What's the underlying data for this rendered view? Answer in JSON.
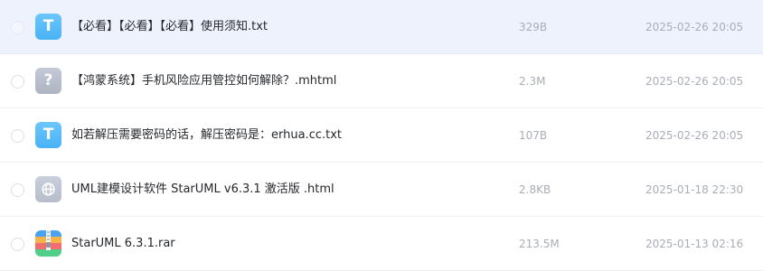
{
  "files": [
    {
      "name": "【必看】【必看】【必看】使用须知.txt",
      "size": "329B",
      "date": "2025-02-26 20:05",
      "icon": "txt-file-icon",
      "icon_glyph": "T"
    },
    {
      "name": "【鸿蒙系统】手机风险应用管控如何解除？.mhtml",
      "size": "2.3M",
      "date": "2025-02-26 20:05",
      "icon": "unknown-file-icon",
      "icon_glyph": "?"
    },
    {
      "name": "如若解压需要密码的话，解压密码是：erhua.cc.txt",
      "size": "107B",
      "date": "2025-02-26 20:05",
      "icon": "txt-file-icon",
      "icon_glyph": "T"
    },
    {
      "name": "UML建模设计软件 StarUML v6.3.1 激活版 .html",
      "size": "2.8KB",
      "date": "2025-01-18 22:30",
      "icon": "html-file-icon"
    },
    {
      "name": "StarUML 6.3.1.rar",
      "size": "213.5M",
      "date": "2025-01-13 02:16",
      "icon": "archive-file-icon"
    }
  ],
  "colors": {
    "hover_row": "#eef2fd",
    "txt_icon": "#55b9f8",
    "unknown_icon": "#b8bfcc",
    "name_text": "#25272b",
    "meta_text": "#a9adb5"
  }
}
